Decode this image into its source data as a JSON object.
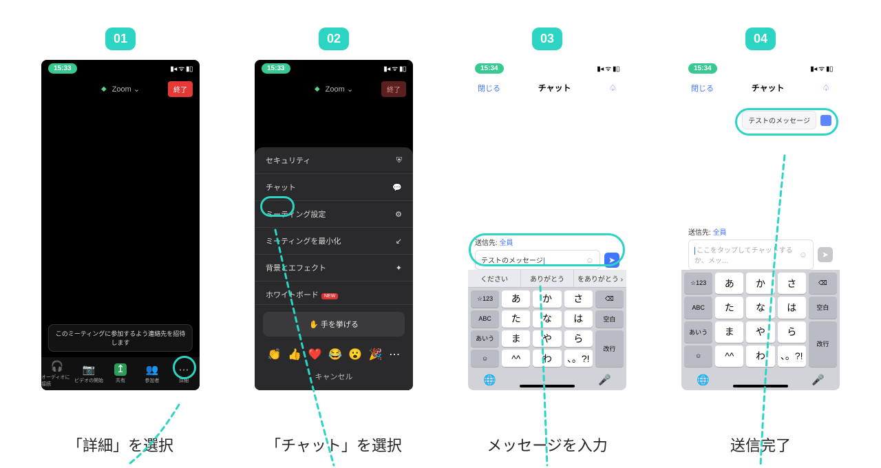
{
  "accent": "#2bd4c3",
  "steps": [
    {
      "num": "01",
      "caption": "「詳細」を選択"
    },
    {
      "num": "02",
      "caption": "「チャット」を選択"
    },
    {
      "num": "03",
      "caption": "メッセージを入力"
    },
    {
      "num": "04",
      "caption": "送信完了"
    }
  ],
  "status": {
    "time1": "15:33",
    "time2": "15:34",
    "icons": "▪▫◂ ᯤ ▮▯"
  },
  "zoom": {
    "title": "Zoom",
    "end": "終了",
    "tooltip": "このミーティングに参加するよう連絡先を招待\nします",
    "footer": [
      "オーディオに接続",
      "ビデオの開始",
      "共有",
      "参加者",
      "詳細"
    ],
    "menu": [
      {
        "label": "セキュリティ",
        "icon": "⛨"
      },
      {
        "label": "チャット",
        "icon": "💬"
      },
      {
        "label": "ミーティング設定",
        "icon": "⚙"
      },
      {
        "label": "ミーティングを最小化",
        "icon": "↙"
      },
      {
        "label": "背景とエフェクト",
        "icon": "✦"
      },
      {
        "label": "ホワイトボード",
        "icon": "",
        "new": true
      }
    ],
    "raise": "手を挙げる",
    "handEmoji": "✋",
    "emojis": [
      "👏",
      "👍",
      "❤️",
      "😂",
      "😮",
      "🎉",
      "⋯"
    ],
    "cancel": "キャンセル",
    "newLabel": "NEW"
  },
  "chat": {
    "close": "閉じる",
    "title": "チャット",
    "destLabel": "送信先:",
    "destWho": "全員",
    "message": "テストのメッセージ",
    "placeholder": "ここをタップしてチャットするか、メッ…",
    "bell": "🔔"
  },
  "kbd": {
    "suggestions": [
      "ください",
      "ありがとう",
      "をありがとう"
    ],
    "rows": [
      [
        "☆123",
        "あ",
        "か",
        "さ",
        "⌫"
      ],
      [
        "ABC",
        "た",
        "な",
        "は",
        "空白"
      ],
      [
        "あいう",
        "ま",
        "や",
        "ら",
        "改行"
      ],
      [
        "☺",
        "^^",
        "わ",
        "、。?!",
        ""
      ]
    ],
    "globe": "🌐",
    "mic": "🎤"
  }
}
